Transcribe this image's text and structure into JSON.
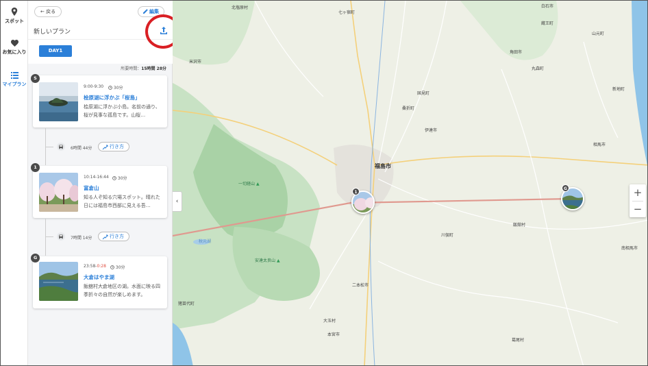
{
  "nav": {
    "items": [
      {
        "label": "スポット",
        "icon": "location-pin-icon"
      },
      {
        "label": "お気に入り",
        "icon": "heart-icon"
      },
      {
        "label": "マイプラン",
        "icon": "list-icon",
        "active": true
      }
    ]
  },
  "panel": {
    "back_label": "← 戻る",
    "edit_label": "編集",
    "plan_title": "新しいプラン",
    "day_tab": "DAY1",
    "duration_label": "所要時間：",
    "duration_value": "15時間 28分"
  },
  "spots": [
    {
      "badge": "S",
      "time": "9:00-9:30",
      "time_late": "",
      "stay": "30分",
      "name": "桧原湖に浮かぶ「桜島」",
      "desc": "桧原湖に浮かぶ小島。名前の通り、桜が見事な孤島です。山桜…"
    },
    {
      "badge": "1",
      "time": "10:14-16:44",
      "time_late": "",
      "stay": "30分",
      "name": "富倉山",
      "desc": "知る人ぞ知る穴場スポット。晴れた日には福島市西部に見える吾…"
    },
    {
      "badge": "G",
      "time": "23:58-",
      "time_late": "0:28",
      "stay": "30分",
      "name": "大倉はやま湖",
      "desc": "飯舘村大倉地区の湖。水面に映る四季折々の自然が楽しめます。"
    }
  ],
  "transits": [
    {
      "time": "6時間 44分",
      "route_label": "行き方"
    },
    {
      "time": "7時間 14分",
      "route_label": "行き方"
    }
  ],
  "map": {
    "labels": {
      "l1": "福島市",
      "l2": "一切経山",
      "l3": "安達太良山",
      "l4": "米沢市",
      "l5": "国見町",
      "l6": "桑折町",
      "l7": "伊達市",
      "l8": "川俣町",
      "l9": "二本松市",
      "l10": "大玉村",
      "l11": "本宮市",
      "l12": "猪苗代町",
      "l13": "飯舘村",
      "l14": "南相馬市",
      "l15": "相馬市",
      "l16": "丸森町",
      "l17": "白石市",
      "l18": "七ヶ宿町",
      "l19": "蔵王町",
      "l20": "葛尾村",
      "l21": "秋元湖",
      "l22": "山元町",
      "l23": "新地町",
      "l24": "角田市",
      "l25": "北塩原村"
    },
    "pin_badges": {
      "mid": "1",
      "end": "G"
    },
    "zoom_in": "+",
    "zoom_out": "−",
    "collapse": "‹"
  },
  "colors": {
    "accent": "#2b7fd8",
    "highlight": "#d91f24",
    "route": "#e0998f"
  }
}
